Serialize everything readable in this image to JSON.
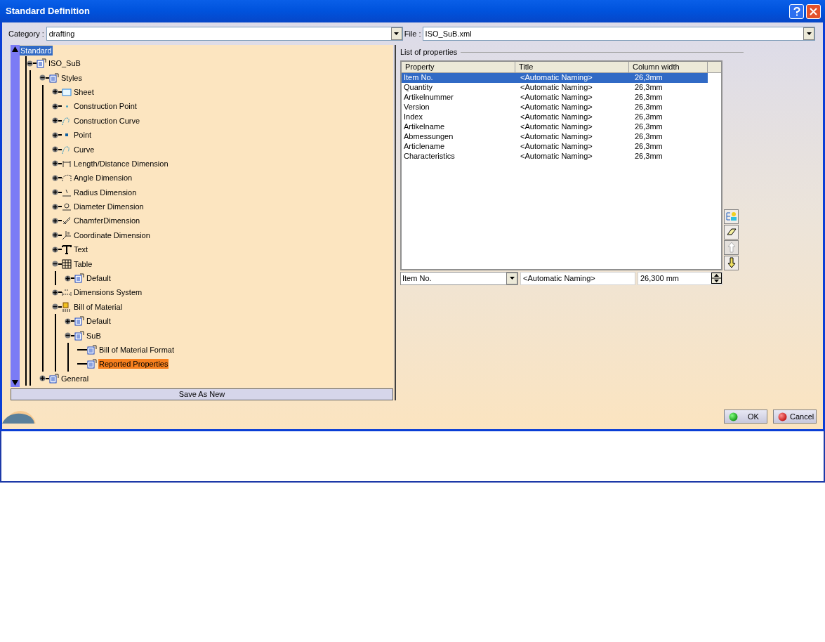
{
  "window": {
    "title": "Standard Definition"
  },
  "category": {
    "label": "Category :",
    "value": "drafting"
  },
  "file": {
    "label": "File :",
    "value": "ISO_SuB.xml"
  },
  "tree": {
    "label": "Standard",
    "focused": true,
    "children": [
      {
        "label": "ISO_SuB",
        "kind": "branch",
        "expanded": true,
        "selected": false,
        "children": [
          {
            "label": "Styles",
            "kind": "branch",
            "expanded": true,
            "selected": false,
            "children": [
              {
                "label": "Sheet",
                "kind": "branch",
                "expanded": false,
                "selected": false
              },
              {
                "label": "Construction Point",
                "kind": "branch",
                "expanded": false,
                "selected": false
              },
              {
                "label": "Construction Curve",
                "kind": "branch",
                "expanded": false,
                "selected": false
              },
              {
                "label": "Point",
                "kind": "branch",
                "expanded": false,
                "selected": false
              },
              {
                "label": "Curve",
                "kind": "branch",
                "expanded": false,
                "selected": false
              },
              {
                "label": "Length/Distance Dimension",
                "kind": "branch",
                "expanded": false,
                "selected": false
              },
              {
                "label": "Angle Dimension",
                "kind": "branch",
                "expanded": false,
                "selected": false
              },
              {
                "label": "Radius Dimension",
                "kind": "branch",
                "expanded": false,
                "selected": false
              },
              {
                "label": "Diameter Dimension",
                "kind": "branch",
                "expanded": false,
                "selected": false
              },
              {
                "label": "ChamferDimension",
                "kind": "branch",
                "expanded": false,
                "selected": false
              },
              {
                "label": "Coordinate Dimension",
                "kind": "branch",
                "expanded": false,
                "selected": false
              },
              {
                "label": "Text",
                "kind": "branch",
                "expanded": false,
                "selected": false
              },
              {
                "label": "Table",
                "kind": "branch",
                "expanded": true,
                "selected": false,
                "children": [
                  {
                    "label": "Default",
                    "kind": "branch",
                    "expanded": false,
                    "selected": false
                  }
                ]
              },
              {
                "label": "Dimensions System",
                "kind": "branch",
                "expanded": false,
                "selected": false
              },
              {
                "label": "Bill of Material",
                "kind": "branch",
                "expanded": true,
                "selected": false,
                "children": [
                  {
                    "label": "Default",
                    "kind": "branch",
                    "expanded": false,
                    "selected": false
                  },
                  {
                    "label": "SuB",
                    "kind": "branch",
                    "expanded": true,
                    "selected": false,
                    "children": [
                      {
                        "label": "Bill of Material Format",
                        "kind": "leaf",
                        "selected": false
                      },
                      {
                        "label": "Reported Properties",
                        "kind": "leaf",
                        "selected": true
                      }
                    ]
                  }
                ]
              }
            ]
          },
          {
            "label": "General",
            "kind": "branch",
            "expanded": false,
            "selected": false
          }
        ]
      }
    ]
  },
  "save_button": "Save As New",
  "properties": {
    "title": "List of properties",
    "columns": [
      "Property",
      "Title",
      "Column width"
    ],
    "rows": [
      {
        "cells": [
          "Item No.",
          "<Automatic Naming>",
          "26,3mm"
        ],
        "selected": true
      },
      {
        "cells": [
          "Quantity",
          "<Automatic Naming>",
          "26,3mm"
        ],
        "selected": false
      },
      {
        "cells": [
          "Artikelnummer",
          "<Automatic Naming>",
          "26,3mm"
        ],
        "selected": false
      },
      {
        "cells": [
          "Version",
          "<Automatic Naming>",
          "26,3mm"
        ],
        "selected": false
      },
      {
        "cells": [
          "Index",
          "<Automatic Naming>",
          "26,3mm"
        ],
        "selected": false
      },
      {
        "cells": [
          "Artikelname",
          "<Automatic Naming>",
          "26,3mm"
        ],
        "selected": false
      },
      {
        "cells": [
          "Abmessungen",
          "<Automatic Naming>",
          "26,3mm"
        ],
        "selected": false
      },
      {
        "cells": [
          "Articlename",
          "<Automatic Naming>",
          "26,3mm"
        ],
        "selected": false
      },
      {
        "cells": [
          "Characteristics",
          "<Automatic Naming>",
          "26,3mm"
        ],
        "selected": false
      }
    ],
    "tools": [
      {
        "kind": "add",
        "disabled": false
      },
      {
        "kind": "erase",
        "disabled": false
      },
      {
        "kind": "up",
        "disabled": true
      },
      {
        "kind": "down",
        "disabled": false
      }
    ],
    "editor": {
      "property": "Item No.",
      "title": "<Automatic Naming>",
      "width": "26,300 mm"
    }
  },
  "buttons": [
    {
      "kind": "ok",
      "label": "OK"
    },
    {
      "kind": "cancel",
      "label": "Cancel"
    }
  ]
}
